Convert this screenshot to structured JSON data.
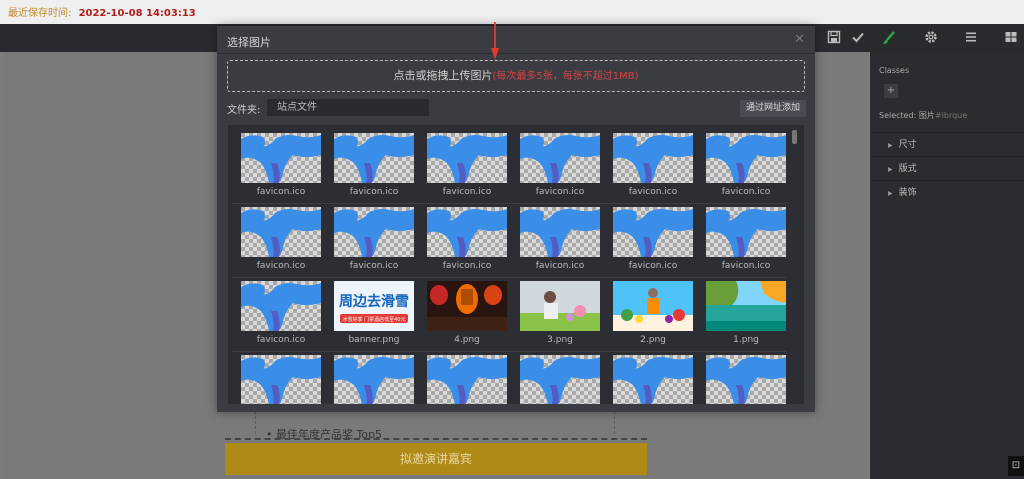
{
  "header": {
    "last_saved_label": "最近保存时间:",
    "last_saved_time": "2022-10-08 14:03:13"
  },
  "toolbar": {
    "icons": [
      "save-icon",
      "check-icon",
      "brush-icon",
      "gear-icon",
      "menu-icon",
      "grid-icon"
    ]
  },
  "modal": {
    "title": "选择图片",
    "upload_text": "点击或拖拽上传图片",
    "upload_note": "(每次最多5张，每张不超过1MB)",
    "folder_label": "文件夹:",
    "folder_value": "站点文件",
    "url_add_button": "通过网址添加",
    "rows": [
      [
        {
          "name": "favicon.ico",
          "kind": "favicon"
        },
        {
          "name": "favicon.ico",
          "kind": "favicon"
        },
        {
          "name": "favicon.ico",
          "kind": "favicon"
        },
        {
          "name": "favicon.ico",
          "kind": "favicon"
        },
        {
          "name": "favicon.ico",
          "kind": "favicon"
        },
        {
          "name": "favicon.ico",
          "kind": "favicon"
        }
      ],
      [
        {
          "name": "favicon.ico",
          "kind": "favicon"
        },
        {
          "name": "favicon.ico",
          "kind": "favicon"
        },
        {
          "name": "favicon.ico",
          "kind": "favicon"
        },
        {
          "name": "favicon.ico",
          "kind": "favicon"
        },
        {
          "name": "favicon.ico",
          "kind": "favicon"
        },
        {
          "name": "favicon.ico",
          "kind": "favicon"
        }
      ],
      [
        {
          "name": "favicon.ico",
          "kind": "favicon"
        },
        {
          "name": "banner.png",
          "kind": "banner",
          "banner_title": "周边去滑雪",
          "banner_sub": "冰雪好季 门票酒店低至40元"
        },
        {
          "name": "4.png",
          "kind": "lanterns"
        },
        {
          "name": "3.png",
          "kind": "garden"
        },
        {
          "name": "2.png",
          "kind": "fruit"
        },
        {
          "name": "1.png",
          "kind": "lake"
        }
      ],
      [
        {
          "name": "",
          "kind": "favicon"
        },
        {
          "name": "",
          "kind": "favicon"
        },
        {
          "name": "",
          "kind": "favicon"
        },
        {
          "name": "",
          "kind": "favicon"
        },
        {
          "name": "",
          "kind": "favicon"
        },
        {
          "name": "",
          "kind": "favicon"
        }
      ]
    ]
  },
  "right_panel": {
    "classes_title": "Classes",
    "add_label": "+",
    "selected_label": "Selected:",
    "selected_value": "图片",
    "selected_id": "#lbrque",
    "sections": [
      "尺寸",
      "版式",
      "装饰"
    ]
  },
  "page_preview": {
    "list_item": "最佳年度产品奖 Top5",
    "cta_label": "拟邀演讲嘉宾"
  },
  "colors": {
    "accent_red": "#d64343",
    "brush_green": "#2ea843",
    "cta_gold": "#b08a17"
  }
}
